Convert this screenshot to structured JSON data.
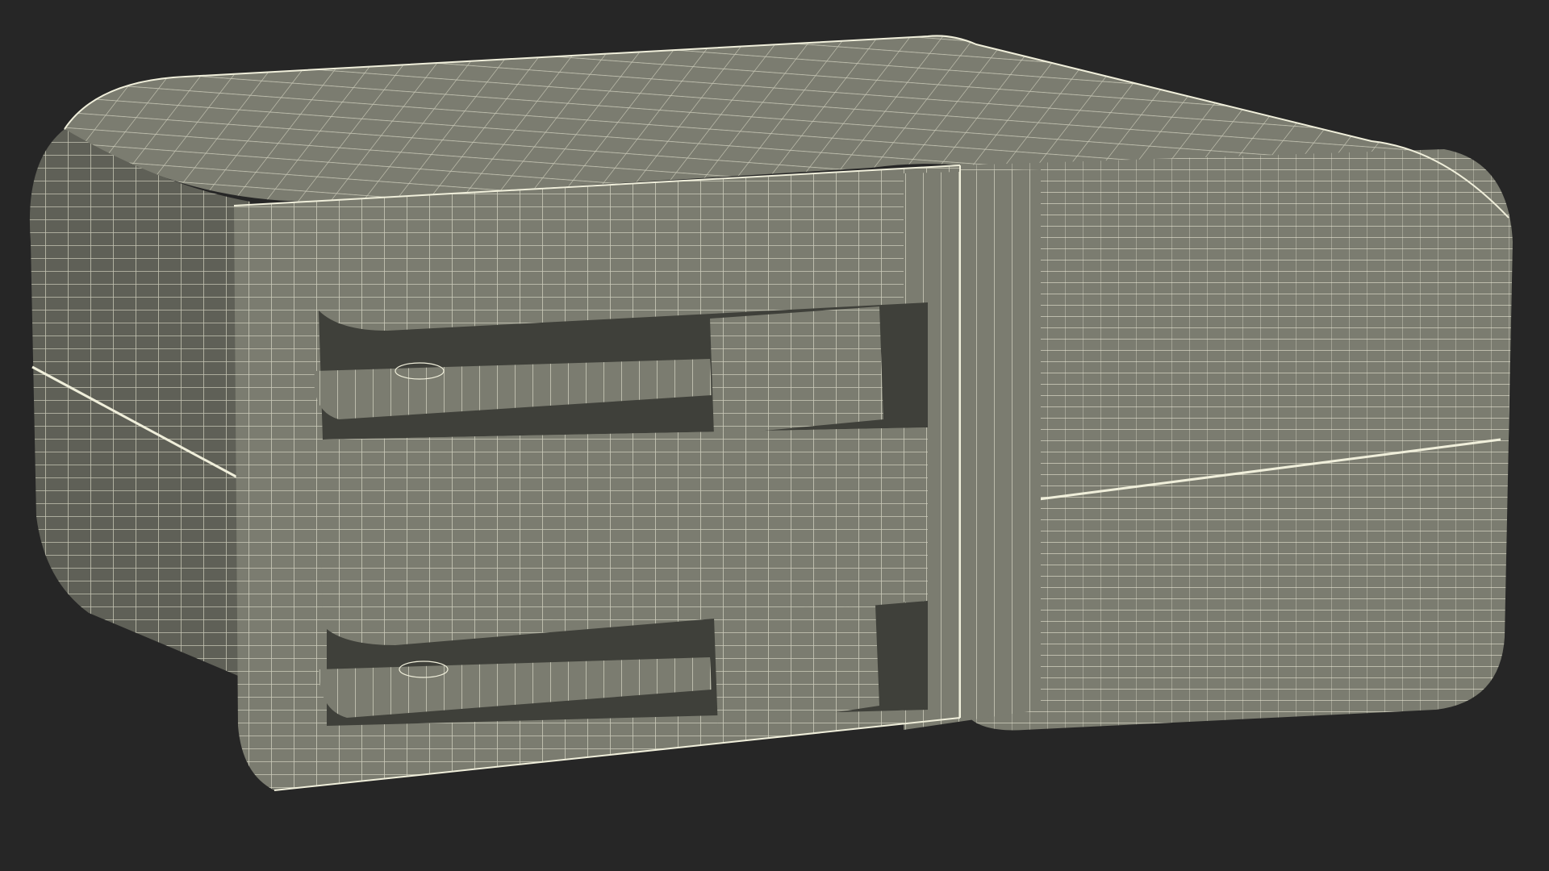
{
  "scene": {
    "subject": "wall-charger-wireframe-render",
    "colors": {
      "background": "#262626",
      "surface": "#7b7c70",
      "surface_dark": "#5f6057",
      "surface_shadow": "#3f403a",
      "wire": "#f0efdb"
    }
  }
}
